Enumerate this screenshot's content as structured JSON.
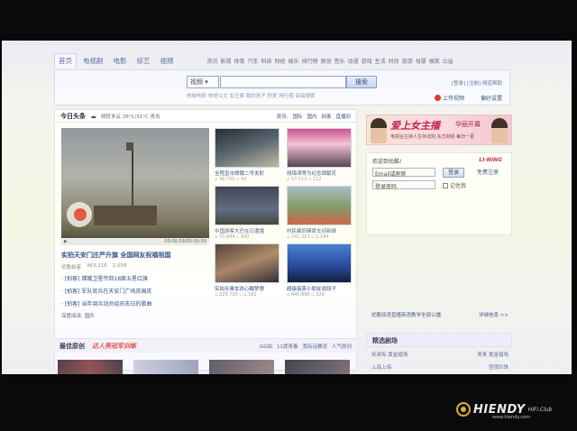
{
  "nav": {
    "channels": [
      "首页",
      "电视剧",
      "电影",
      "综艺",
      "视频"
    ],
    "subchannels": [
      "资讯",
      "影视",
      "体育",
      "汽车",
      "科技",
      "财经",
      "娱乐",
      "排行榜",
      "原创",
      "音乐",
      "动漫",
      "游戏",
      "生活",
      "时尚",
      "旅游",
      "母婴",
      "搞笑",
      "公益"
    ]
  },
  "search": {
    "category": "视频",
    "button": "搜索",
    "hotwords": "热映电影  非常公主  女王嫁  我的孩子  烈爱  排行榜  高级搜索"
  },
  "account": {
    "links": "[登录] [注册] 频道帮助",
    "upload": "上传视频",
    "settings": "偏好设置"
  },
  "today": {
    "title": "今日头条",
    "weather": "晴转多云 26°C/31°C 青岛",
    "tabs": [
      "资讯:",
      "国际",
      "国内",
      "拍客",
      "直播间"
    ],
    "video_time": "00:00:59/00:00:59",
    "headline": "实拍天安门庄严升旗 全国网友祝福祖国",
    "source": "优酷拍客",
    "views": "463,216",
    "comments": "1,058",
    "links": [
      "· [拍客] 嫦娥卫星传回18面五星红旗",
      "· [拍客] 军队官兵在天安门广场庆国庆",
      "· [拍客] 当年阅兵动员组员庆日的歌曲"
    ],
    "deep_read": "深度阅读: 国庆"
  },
  "thumbs": [
    {
      "caption": "全程直击嫦娥二号发射",
      "views": "36,755",
      "comments": "42"
    },
    {
      "caption": "胡锦涛等为纪念碑献花",
      "views": "57,512",
      "comments": "112"
    },
    {
      "caption": "中国游客大巴在日遭围",
      "views": "70,694",
      "comments": "842"
    },
    {
      "caption": "村民聚四辆豪车迎新娘",
      "views": "241,353",
      "comments": "1,184"
    },
    {
      "caption": "实拍无辜女孩心酸梦想",
      "views": "229,730",
      "comments": "1,181"
    },
    {
      "caption": "超级搞笑小朋友说段子",
      "views": "640,696",
      "comments": "329"
    }
  ],
  "strip": {
    "title": "最佳原创",
    "promo": "达人秀冠军训练",
    "links": [
      "GG拍",
      "11度青春",
      "我有话要说",
      "人气原创"
    ]
  },
  "banner": {
    "title": "爱上女主播",
    "title2": "华丽开幕",
    "sub": "电视台主持人生存法则 东方财经 每日一更"
  },
  "login": {
    "welcome": "欢迎到优酷!",
    "brand": "LI-NING",
    "email_placeholder": "Email或昵称",
    "password_placeholder": "登录密码",
    "button": "登录",
    "register": "免费注册",
    "remember": "记住我"
  },
  "side": {
    "promo_left": "优酷双语直播英语教学全部公播",
    "promo_right": "详细信息 >>",
    "jingxuan": "精选剧场",
    "row1": [
      "宋承宪  黄金猎场",
      "来来  黄金猎场"
    ],
    "row2": [
      "上海上海",
      "宫锁珍珠"
    ]
  },
  "watermark": {
    "brand": "HIENDY",
    "sub": "HiFi.Club",
    "url": "www.hiendy.com"
  }
}
